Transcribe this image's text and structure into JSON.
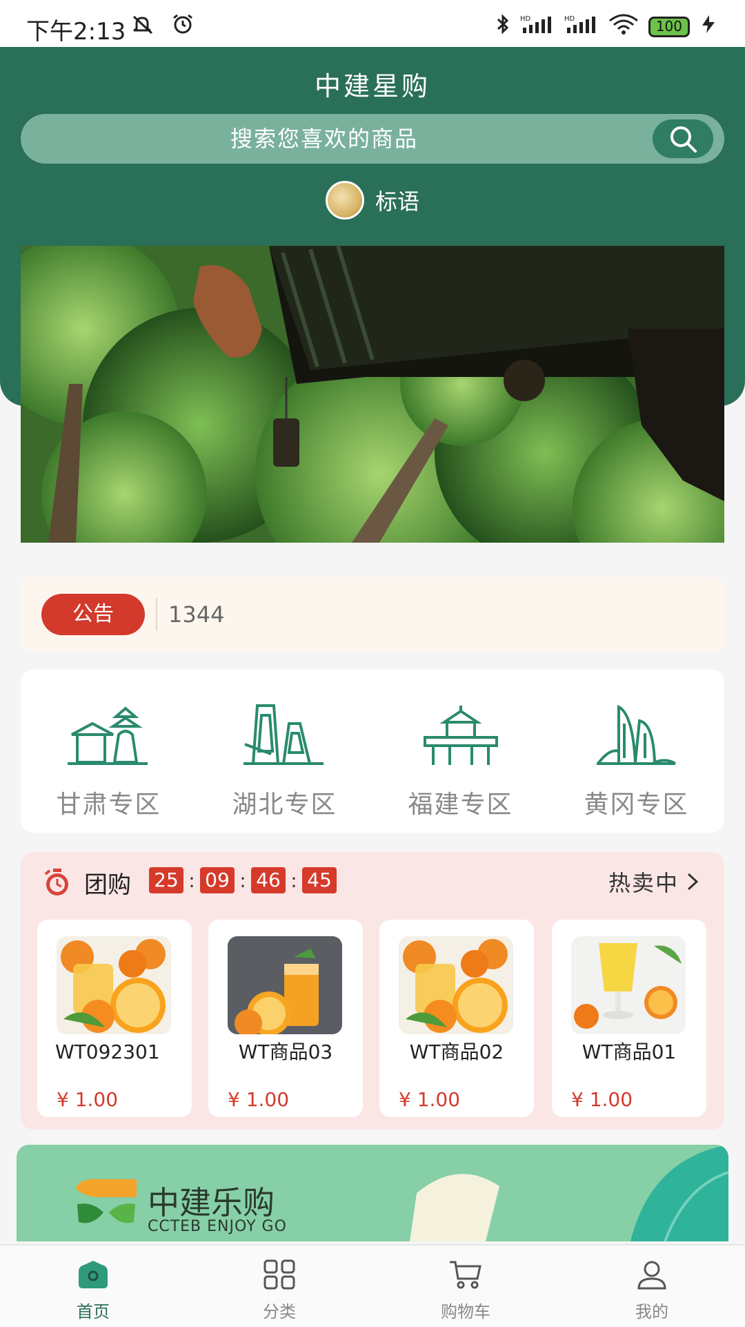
{
  "status_bar": {
    "time": "下午2:13",
    "battery": "100"
  },
  "header": {
    "title": "中建星购",
    "search_placeholder": "搜索您喜欢的商品",
    "slogan": "标语"
  },
  "notice": {
    "tag": "公告",
    "text": "1344"
  },
  "zones": [
    {
      "label": "甘肃专区",
      "icon": "temple-icon"
    },
    {
      "label": "湖北专区",
      "icon": "tower-icon"
    },
    {
      "label": "福建专区",
      "icon": "pavilion-icon"
    },
    {
      "label": "黄冈专区",
      "icon": "building-icon"
    }
  ],
  "group_buy": {
    "title": "团购",
    "timer": [
      "25",
      "09",
      "46",
      "45"
    ],
    "more_label": "热卖中",
    "products": [
      {
        "name": "WT092301",
        "price": "¥ 1.00"
      },
      {
        "name": "WT商品03",
        "price": "¥ 1.00"
      },
      {
        "name": "WT商品02",
        "price": "¥ 1.00"
      },
      {
        "name": "WT商品01",
        "price": "¥ 1.00"
      }
    ]
  },
  "promo": {
    "brand_cn": "中建乐购",
    "brand_en": "CCTEB ENJOY GO"
  },
  "tabs": [
    {
      "label": "首页",
      "icon": "home-icon",
      "active": true
    },
    {
      "label": "分类",
      "icon": "grid-icon",
      "active": false
    },
    {
      "label": "购物车",
      "icon": "cart-icon",
      "active": false
    },
    {
      "label": "我的",
      "icon": "user-icon",
      "active": false
    }
  ],
  "colors": {
    "primary": "#2a6f57",
    "accent_red": "#d33a2c",
    "notice_bg": "#fdf6ee",
    "group_bg": "#fbe6e6"
  }
}
